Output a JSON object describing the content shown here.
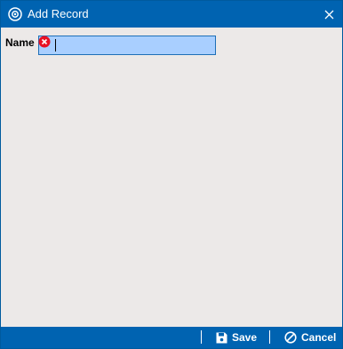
{
  "window": {
    "title": "Add Record",
    "accent_color": "#0063b1",
    "background_color": "#ece9e8"
  },
  "form": {
    "name_label": "Name",
    "name_value": "",
    "name_error_icon": "error-x-icon",
    "error_color": "#e81123"
  },
  "footer": {
    "save_label": "Save",
    "save_icon": "floppy-disk-icon",
    "cancel_label": "Cancel",
    "cancel_icon": "cancel-circle-icon"
  }
}
